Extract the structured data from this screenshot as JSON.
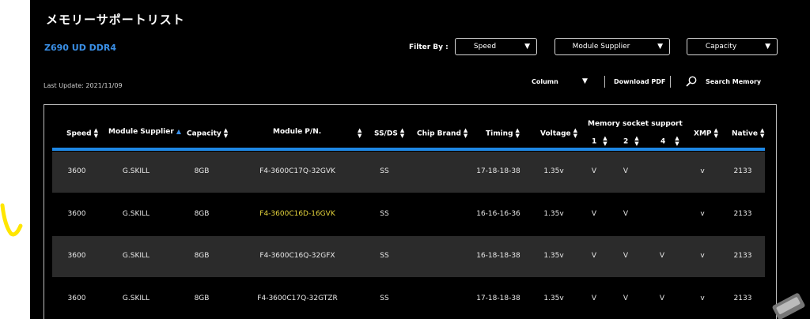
{
  "page": {
    "title": "メモリーサポートリスト",
    "model": "Z690 UD DDR4",
    "last_update": "Last Update: 2021/11/09"
  },
  "filters": {
    "label": "Filter By :",
    "speed": "Speed",
    "supplier": "Module Supplier",
    "capacity": "Capacity"
  },
  "toolbar": {
    "column": "Column",
    "download": "Download PDF",
    "search": "Search Memory"
  },
  "table": {
    "headers": {
      "speed": "Speed",
      "supplier": "Module Supplier",
      "capacity": "Capacity",
      "pn": "Module P/N.",
      "ssds": "SS/DS",
      "chip": "Chip Brand",
      "timing": "Timing",
      "voltage": "Voltage",
      "socket": "Memory socket support",
      "s1": "1",
      "s2": "2",
      "s4": "4",
      "xmp": "XMP",
      "native": "Native"
    },
    "rows": [
      {
        "speed": "3600",
        "supplier": "G.SKILL",
        "capacity": "8GB",
        "pn": "F4-3600C17Q-32GVK",
        "ssds": "SS",
        "chip": "",
        "timing": "17-18-18-38",
        "voltage": "1.35v",
        "s1": "V",
        "s2": "V",
        "s4": "",
        "xmp": "v",
        "native": "2133"
      },
      {
        "speed": "3600",
        "supplier": "G.SKILL",
        "capacity": "8GB",
        "pn": "F4-3600C16D-16GVK",
        "ssds": "SS",
        "chip": "",
        "timing": "16-16-16-36",
        "voltage": "1.35v",
        "s1": "V",
        "s2": "V",
        "s4": "",
        "xmp": "v",
        "native": "2133"
      },
      {
        "speed": "3600",
        "supplier": "G.SKILL",
        "capacity": "8GB",
        "pn": "F4-3600C16Q-32GFX",
        "ssds": "SS",
        "chip": "",
        "timing": "16-18-18-38",
        "voltage": "1.35v",
        "s1": "V",
        "s2": "V",
        "s4": "V",
        "xmp": "v",
        "native": "2133"
      },
      {
        "speed": "3600",
        "supplier": "G.SKILL",
        "capacity": "8GB",
        "pn": "F4-3600C17Q-32GTZR",
        "ssds": "SS",
        "chip": "",
        "timing": "17-18-18-38",
        "voltage": "1.35v",
        "s1": "V",
        "s2": "V",
        "s4": "V",
        "xmp": "v",
        "native": "2133"
      }
    ]
  },
  "colors": {
    "background": "#000000",
    "accent": "#1e88e5",
    "highlight": "#e4d33c",
    "row_shade": "#2b2b2b",
    "annotation": "#ffe600"
  },
  "icons": {
    "search": "search-icon",
    "dropdown": "caret-down-icon",
    "sort": "sort-icon"
  }
}
